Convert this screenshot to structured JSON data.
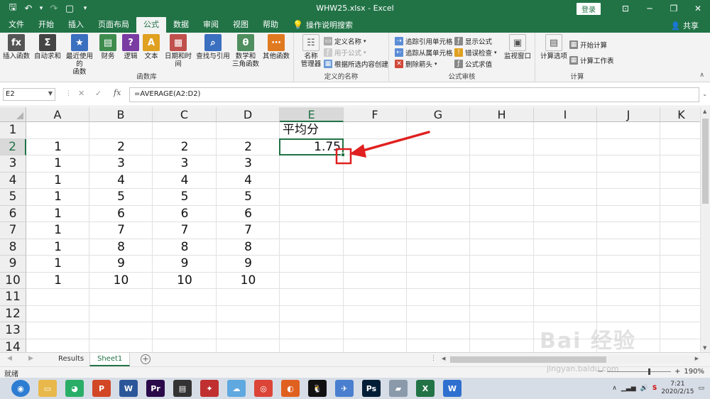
{
  "window": {
    "title": "WHW25.xlsx  -  Excel",
    "login_label": "登录",
    "minimize": "─",
    "restore": "❐",
    "close": "✕",
    "ribbon_toggle": "⊡"
  },
  "qat": {
    "save": "🖫",
    "undo": "↶",
    "undo_dd": "▾",
    "redo": "↷",
    "new": "▢",
    "customize": "▾"
  },
  "tabs": [
    "文件",
    "开始",
    "插入",
    "页面布局",
    "公式",
    "数据",
    "审阅",
    "视图",
    "帮助"
  ],
  "active_tab": "公式",
  "tell_me": "操作说明搜索",
  "share_label": "共享",
  "ribbon": {
    "function_library": {
      "label": "函数库",
      "buttons": [
        {
          "label": "插入函数",
          "icon": "fx",
          "color": "#555555"
        },
        {
          "label": "自动求和",
          "icon": "Σ",
          "color": "#444444"
        },
        {
          "label": "最近使用的\n函数",
          "icon": "★",
          "color": "#3b6fbf"
        },
        {
          "label": "财务",
          "icon": "▤",
          "color": "#3f8c4f"
        },
        {
          "label": "逻辑",
          "icon": "?",
          "color": "#7a3ba3"
        },
        {
          "label": "文本",
          "icon": "A",
          "color": "#e0a020"
        },
        {
          "label": "日期和时间",
          "icon": "▦",
          "color": "#c0504d"
        },
        {
          "label": "查找与引用",
          "icon": "⌕",
          "color": "#3b6fbf"
        },
        {
          "label": "数学和\n三角函数",
          "icon": "θ",
          "color": "#4f8f5f"
        },
        {
          "label": "其他函数",
          "icon": "⋯",
          "color": "#e07a20"
        }
      ]
    },
    "defined_names": {
      "label": "定义的名称",
      "manager": "名称\n管理器",
      "define": "定义名称",
      "use_in": "用于公式",
      "create": "根据所选内容创建"
    },
    "formula_auditing": {
      "label": "公式审核",
      "trace_precedents": "追踪引用单元格",
      "trace_dependents": "追踪从属单元格",
      "remove_arrows": "删除箭头",
      "show_formulas": "显示公式",
      "error_checking": "错误检查",
      "evaluate": "公式求值",
      "watch_window": "监视窗口"
    },
    "calculation": {
      "label": "计算",
      "options": "计算选项",
      "calc_now": "开始计算",
      "calc_sheet": "计算工作表"
    }
  },
  "formula_bar": {
    "name_box": "E2",
    "cancel": "✕",
    "enter": "✓",
    "fx": "fx",
    "formula": "=AVERAGE(A2:D2)"
  },
  "columns": [
    "A",
    "B",
    "C",
    "D",
    "E",
    "F",
    "G",
    "H",
    "I",
    "J",
    "K"
  ],
  "rows": [
    "1",
    "2",
    "3",
    "4",
    "5",
    "6",
    "7",
    "8",
    "9",
    "10",
    "11",
    "12",
    "13",
    "14"
  ],
  "selected_cell": "E2",
  "cells": {
    "E1": "平均分",
    "E2": "1.75",
    "data": [
      [
        "1",
        "2",
        "2",
        "2"
      ],
      [
        "1",
        "3",
        "3",
        "3"
      ],
      [
        "1",
        "4",
        "4",
        "4"
      ],
      [
        "1",
        "5",
        "5",
        "5"
      ],
      [
        "1",
        "6",
        "6",
        "6"
      ],
      [
        "1",
        "7",
        "7",
        "7"
      ],
      [
        "1",
        "8",
        "8",
        "8"
      ],
      [
        "1",
        "9",
        "9",
        "9"
      ],
      [
        "1",
        "10",
        "10",
        "10"
      ]
    ]
  },
  "sheets": [
    "Results",
    "Sheet1"
  ],
  "active_sheet": "Sheet1",
  "status": {
    "ready": "就绪",
    "zoom": "190%"
  },
  "taskbar": {
    "apps": [
      {
        "name": "browser",
        "color": "#2d7dd2",
        "glyph": "◉"
      },
      {
        "name": "explorer",
        "color": "#e8b84a",
        "glyph": "▭"
      },
      {
        "name": "wechat",
        "color": "#2aae67",
        "glyph": "◕"
      },
      {
        "name": "powerpoint",
        "color": "#d24726",
        "glyph": "P"
      },
      {
        "name": "word",
        "color": "#2b579a",
        "glyph": "W"
      },
      {
        "name": "premiere",
        "color": "#2a0a4a",
        "glyph": "Pr"
      },
      {
        "name": "video-editor",
        "color": "#333333",
        "glyph": "▤"
      },
      {
        "name": "media",
        "color": "#c03030",
        "glyph": "✦"
      },
      {
        "name": "cloud",
        "color": "#5fa8e0",
        "glyph": "☁"
      },
      {
        "name": "chrome",
        "color": "#db4437",
        "glyph": "◎"
      },
      {
        "name": "app-orange",
        "color": "#e06020",
        "glyph": "◐"
      },
      {
        "name": "qq",
        "color": "#111111",
        "glyph": "🐧"
      },
      {
        "name": "app-blue",
        "color": "#4a7fd0",
        "glyph": "✈"
      },
      {
        "name": "photoshop",
        "color": "#001e36",
        "glyph": "Ps"
      },
      {
        "name": "app-gray",
        "color": "#8a9aaa",
        "glyph": "▰"
      },
      {
        "name": "excel",
        "color": "#217346",
        "glyph": "X"
      },
      {
        "name": "wps",
        "color": "#2f6fd0",
        "glyph": "W"
      }
    ],
    "time": "7:21",
    "date": "2020/2/15"
  },
  "watermark": {
    "text": "Bai 经验",
    "url": "jingyan.baidu.com"
  }
}
